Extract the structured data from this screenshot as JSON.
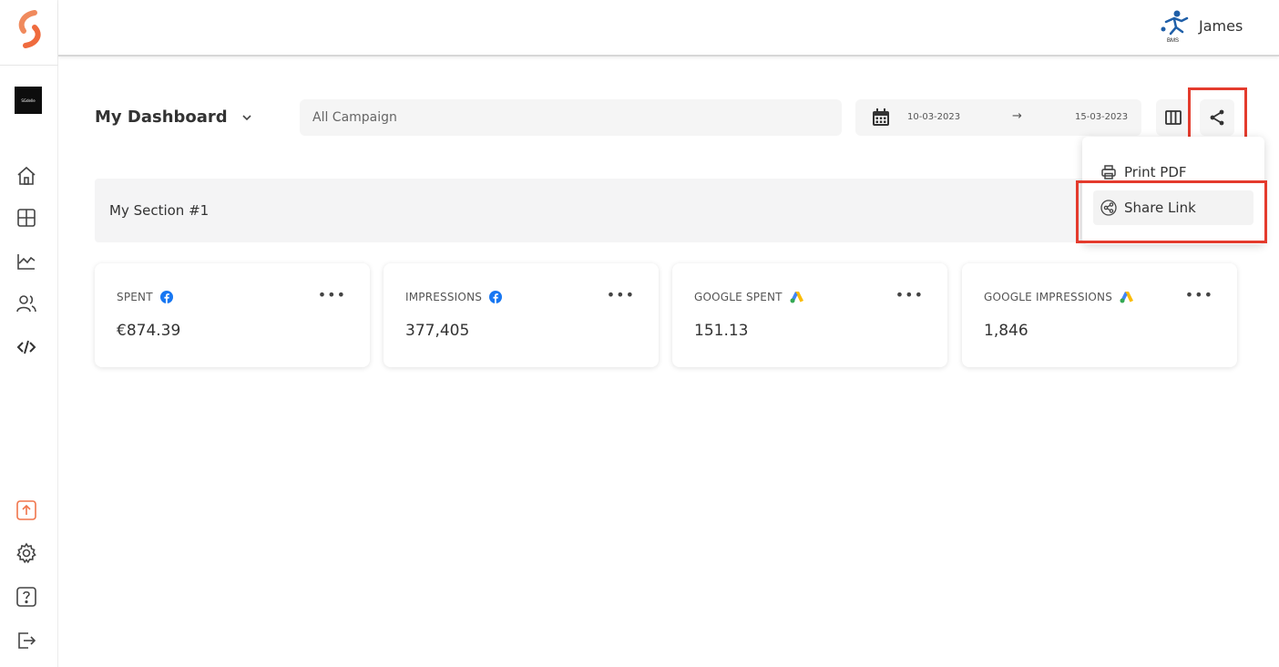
{
  "user": {
    "name": "James",
    "logo_caption": "BMS"
  },
  "brand": {
    "tile_text": "SGdelle"
  },
  "sidebar": {
    "top_items": [
      {
        "name": "home",
        "icon": "home-icon"
      },
      {
        "name": "dashboards",
        "icon": "grid-icon"
      },
      {
        "name": "reports",
        "icon": "chart-icon"
      },
      {
        "name": "users",
        "icon": "users-icon"
      },
      {
        "name": "integrations",
        "icon": "code-icon"
      }
    ],
    "bottom_items": [
      {
        "name": "upload",
        "icon": "upload-icon"
      },
      {
        "name": "settings",
        "icon": "gear-icon"
      },
      {
        "name": "help",
        "icon": "help-icon"
      },
      {
        "name": "logout",
        "icon": "logout-icon"
      }
    ]
  },
  "toolbar": {
    "dashboard_title": "My Dashboard",
    "campaign_value": "All Campaign",
    "date_from": "10-03-2023",
    "date_arrow": "→",
    "date_to": "15-03-2023"
  },
  "section": {
    "title": "My Section #1"
  },
  "cards": [
    {
      "label": "SPENT",
      "source": "facebook",
      "value": "€874.39"
    },
    {
      "label": "IMPRESSIONS",
      "source": "facebook",
      "value": "377,405"
    },
    {
      "label": "GOOGLE SPENT",
      "source": "google-ads",
      "value": "151.13"
    },
    {
      "label": "GOOGLE IMPRESSIONS",
      "source": "google-ads",
      "value": "1,846"
    }
  ],
  "share_menu": {
    "print_label": "Print PDF",
    "share_label": "Share Link"
  },
  "colors": {
    "accent_orange": "#f0754b",
    "highlight": "#e43b2d",
    "facebook": "#1877f2"
  }
}
